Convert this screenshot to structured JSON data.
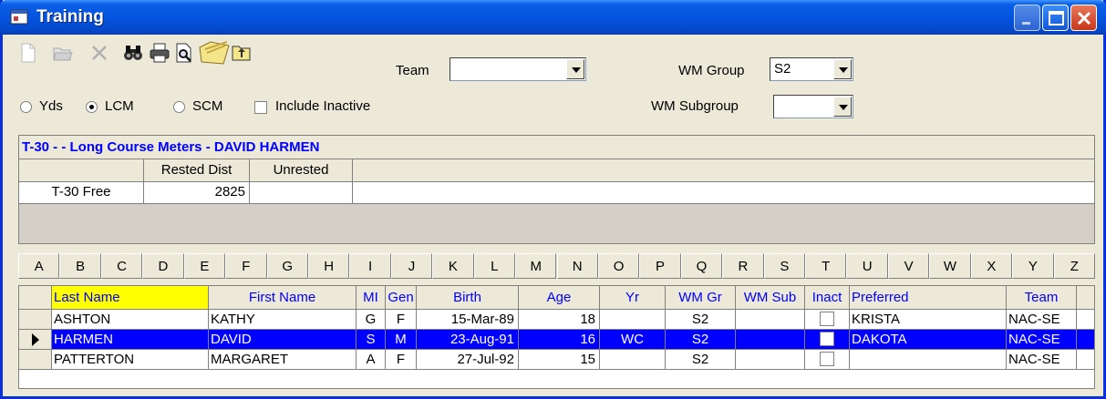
{
  "window": {
    "title": "Training"
  },
  "toolbar": {
    "icons": [
      "new-icon",
      "open-icon",
      "delete-icon",
      "find-icon",
      "print-icon",
      "print-preview-icon",
      "folder-icon",
      "export-icon"
    ]
  },
  "filters": {
    "team_label": "Team",
    "team_value": "",
    "wm_group_label": "WM Group",
    "wm_group_value": "S2",
    "wm_subgroup_label": "WM Subgroup",
    "wm_subgroup_value": "",
    "course_options": [
      {
        "label": "Yds",
        "selected": false
      },
      {
        "label": "LCM",
        "selected": true
      },
      {
        "label": "SCM",
        "selected": false
      }
    ],
    "include_inactive_label": "Include Inactive",
    "include_inactive_checked": false
  },
  "test_panel": {
    "title": "T-30 -  - Long Course Meters - DAVID HARMEN",
    "columns": [
      "",
      "Rested Dist",
      "Unrested"
    ],
    "rows": [
      {
        "event": "T-30 Free",
        "rested": "2825",
        "unrested": ""
      }
    ]
  },
  "alphabet": [
    "A",
    "B",
    "C",
    "D",
    "E",
    "F",
    "G",
    "H",
    "I",
    "J",
    "K",
    "L",
    "M",
    "N",
    "O",
    "P",
    "Q",
    "R",
    "S",
    "T",
    "U",
    "V",
    "W",
    "X",
    "Y",
    "Z"
  ],
  "roster": {
    "columns": [
      "Last Name",
      "First Name",
      "MI",
      "Gen",
      "Birth",
      "Age",
      "Yr",
      "WM Gr",
      "WM Sub",
      "Inact",
      "Preferred",
      "Team"
    ],
    "rows": [
      {
        "last": "ASHTON",
        "first": "KATHY",
        "mi": "G",
        "gen": "F",
        "birth": "15-Mar-89",
        "age": "18",
        "yr": "",
        "wmgr": "S2",
        "wmsub": "",
        "inact": false,
        "preferred": "KRISTA",
        "team": "NAC-SE",
        "selected": false
      },
      {
        "last": "HARMEN",
        "first": "DAVID",
        "mi": "S",
        "gen": "M",
        "birth": "23-Aug-91",
        "age": "16",
        "yr": "WC",
        "wmgr": "S2",
        "wmsub": "",
        "inact": false,
        "preferred": "DAKOTA",
        "team": "NAC-SE",
        "selected": true
      },
      {
        "last": "PATTERTON",
        "first": "MARGARET",
        "mi": "A",
        "gen": "F",
        "birth": "27-Jul-92",
        "age": "15",
        "yr": "",
        "wmgr": "S2",
        "wmsub": "",
        "inact": false,
        "preferred": "",
        "team": "NAC-SE",
        "selected": false
      }
    ]
  },
  "colors": {
    "title_bar": "#0554e0",
    "selection": "#0000ff",
    "header_text": "#0000ff",
    "sort_header": "#ffff00",
    "window_bg": "#ece9d8"
  }
}
